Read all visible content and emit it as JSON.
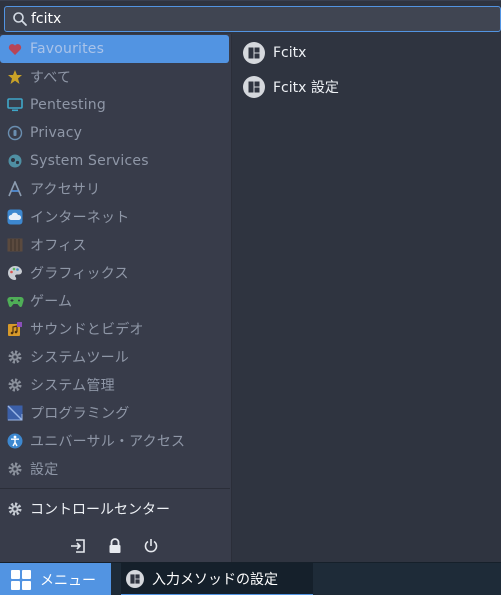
{
  "search": {
    "value": "fcitx",
    "icon": "search-icon"
  },
  "sidebar": {
    "categories": [
      {
        "label": "Favourites",
        "icon": "heart-icon",
        "selected": true
      },
      {
        "label": "すべて",
        "icon": "star-icon"
      },
      {
        "label": "Pentesting",
        "icon": "monitor-icon"
      },
      {
        "label": "Privacy",
        "icon": "privacy-icon"
      },
      {
        "label": "System Services",
        "icon": "services-icon"
      },
      {
        "label": "アクセサリ",
        "icon": "accessories-icon"
      },
      {
        "label": "インターネット",
        "icon": "cloud-icon"
      },
      {
        "label": "オフィス",
        "icon": "office-icon"
      },
      {
        "label": "グラフィックス",
        "icon": "palette-icon"
      },
      {
        "label": "ゲーム",
        "icon": "gamepad-icon"
      },
      {
        "label": "サウンドとビデオ",
        "icon": "multimedia-icon"
      },
      {
        "label": "システムツール",
        "icon": "gear-icon"
      },
      {
        "label": "システム管理",
        "icon": "gear-icon"
      },
      {
        "label": "プログラミング",
        "icon": "programming-icon"
      },
      {
        "label": "ユニバーサル・アクセス",
        "icon": "accessibility-icon"
      },
      {
        "label": "設定",
        "icon": "gear-icon"
      }
    ],
    "control_center": {
      "label": "コントロールセンター",
      "icon": "gear-icon"
    },
    "system_buttons": [
      {
        "name": "logout-icon"
      },
      {
        "name": "lock-icon"
      },
      {
        "name": "power-icon"
      }
    ]
  },
  "results": [
    {
      "label": "Fcitx",
      "icon": "fcitx-icon"
    },
    {
      "label": "Fcitx 設定",
      "icon": "fcitx-icon"
    }
  ],
  "taskbar": {
    "menu_label": "メニュー",
    "task_label": "入力メソッドの設定"
  },
  "colors": {
    "accent": "#5294e2",
    "sidebar_bg": "#383c4a",
    "panel_bg": "#2f3440",
    "taskbar_bg": "#1e2b38"
  }
}
